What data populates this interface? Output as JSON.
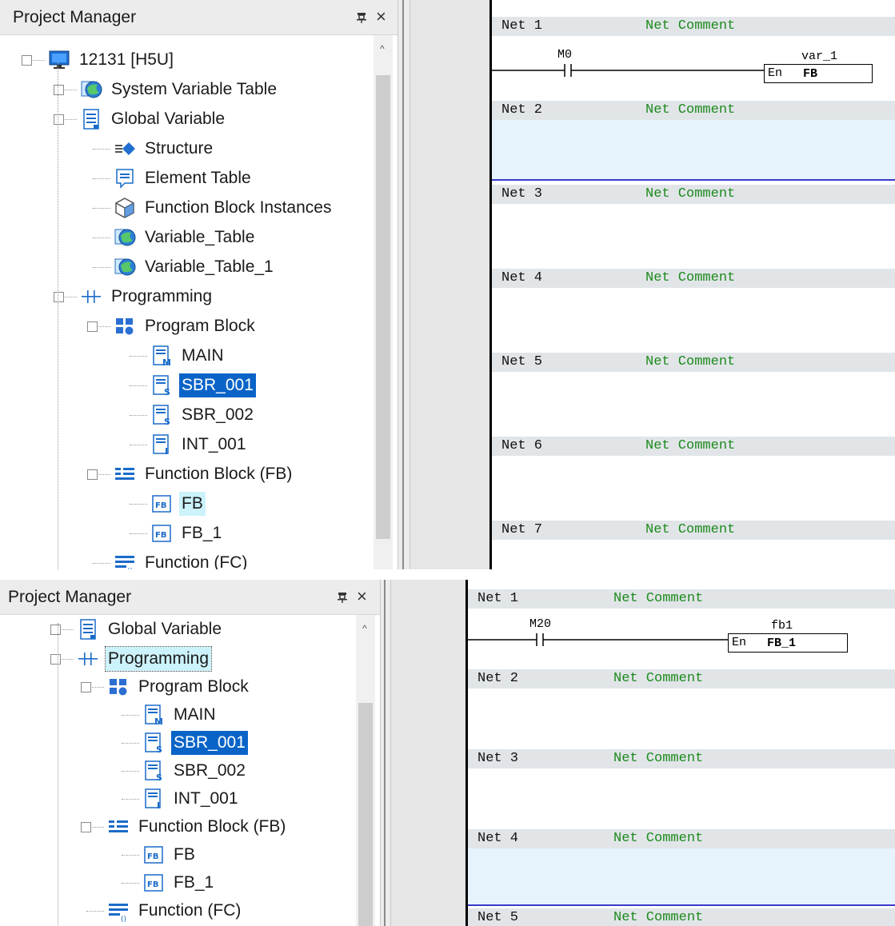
{
  "panel_title": "Project Manager",
  "pin_icon": "pin-icon",
  "close_icon": "×",
  "scroll_up": "^",
  "top": {
    "tree": [
      {
        "id": "t-root",
        "label": "12131 [H5U]",
        "icon": "computer-icon",
        "expander": "−"
      },
      {
        "id": "t-sysvar",
        "label": "System Variable Table",
        "icon": "globe-table-icon",
        "expander": "+"
      },
      {
        "id": "t-global",
        "label": "Global Variable",
        "icon": "document-icon",
        "expander": "−"
      },
      {
        "id": "t-structure",
        "label": "Structure",
        "icon": "structure-icon"
      },
      {
        "id": "t-element",
        "label": "Element Table",
        "icon": "element-table-icon"
      },
      {
        "id": "t-fbinst",
        "label": "Function Block Instances",
        "icon": "cube-icon"
      },
      {
        "id": "t-vartable",
        "label": "Variable_Table",
        "icon": "globe-table-icon"
      },
      {
        "id": "t-vartable1",
        "label": "Variable_Table_1",
        "icon": "globe-table-icon"
      },
      {
        "id": "t-programming",
        "label": "Programming",
        "icon": "ladder-icon",
        "expander": "−"
      },
      {
        "id": "t-progblock",
        "label": "Program Block",
        "icon": "blocks-icon",
        "expander": "−"
      },
      {
        "id": "t-main",
        "label": "MAIN",
        "icon": "program-m-icon"
      },
      {
        "id": "t-sbr001",
        "label": "SBR_001",
        "icon": "program-s-icon",
        "state": "selected"
      },
      {
        "id": "t-sbr002",
        "label": "SBR_002",
        "icon": "program-s-icon"
      },
      {
        "id": "t-int001",
        "label": "INT_001",
        "icon": "program-i-icon"
      },
      {
        "id": "t-fbgroup",
        "label": "Function Block (FB)",
        "icon": "fb-group-icon",
        "expander": "−"
      },
      {
        "id": "t-fb",
        "label": "FB",
        "icon": "fb-icon",
        "state": "highlight"
      },
      {
        "id": "t-fb1",
        "label": "FB_1",
        "icon": "fb-icon"
      },
      {
        "id": "t-fc",
        "label": "Function (FC)",
        "icon": "fc-group-icon"
      }
    ],
    "nets": [
      {
        "label": "Net 1",
        "comment": "Net Comment"
      },
      {
        "label": "Net 2",
        "comment": "Net Comment"
      },
      {
        "label": "Net 3",
        "comment": "Net Comment"
      },
      {
        "label": "Net 4",
        "comment": "Net Comment"
      },
      {
        "label": "Net 5",
        "comment": "Net Comment"
      },
      {
        "label": "Net 6",
        "comment": "Net Comment"
      },
      {
        "label": "Net 7",
        "comment": "Net Comment"
      }
    ],
    "contact": "M0",
    "instance": "var_1",
    "fb_en": "En",
    "fb_name": "FB"
  },
  "bottom": {
    "tree": [
      {
        "id": "b-global",
        "label": "Global Variable",
        "icon": "document-icon",
        "expander": "+"
      },
      {
        "id": "b-programming",
        "label": "Programming",
        "icon": "ladder-icon",
        "expander": "−",
        "state": "focus"
      },
      {
        "id": "b-progblock",
        "label": "Program Block",
        "icon": "blocks-icon",
        "expander": "−"
      },
      {
        "id": "b-main",
        "label": "MAIN",
        "icon": "program-m-icon"
      },
      {
        "id": "b-sbr001",
        "label": "SBR_001",
        "icon": "program-s-icon",
        "state": "selected"
      },
      {
        "id": "b-sbr002",
        "label": "SBR_002",
        "icon": "program-s-icon"
      },
      {
        "id": "b-int001",
        "label": "INT_001",
        "icon": "program-i-icon"
      },
      {
        "id": "b-fbgroup",
        "label": "Function Block (FB)",
        "icon": "fb-group-icon",
        "expander": "−"
      },
      {
        "id": "b-fb",
        "label": "FB",
        "icon": "fb-icon"
      },
      {
        "id": "b-fb1",
        "label": "FB_1",
        "icon": "fb-icon"
      },
      {
        "id": "b-fc",
        "label": "Function (FC)",
        "icon": "fc-group-icon"
      }
    ],
    "nets": [
      {
        "label": "Net 1",
        "comment": "Net Comment"
      },
      {
        "label": "Net 2",
        "comment": "Net Comment"
      },
      {
        "label": "Net 3",
        "comment": "Net Comment"
      },
      {
        "label": "Net 4",
        "comment": "Net Comment"
      },
      {
        "label": "Net 5",
        "comment": "Net Comment"
      }
    ],
    "contact": "M20",
    "instance": "fb1",
    "fb_en": "En",
    "fb_name": "FB_1"
  }
}
